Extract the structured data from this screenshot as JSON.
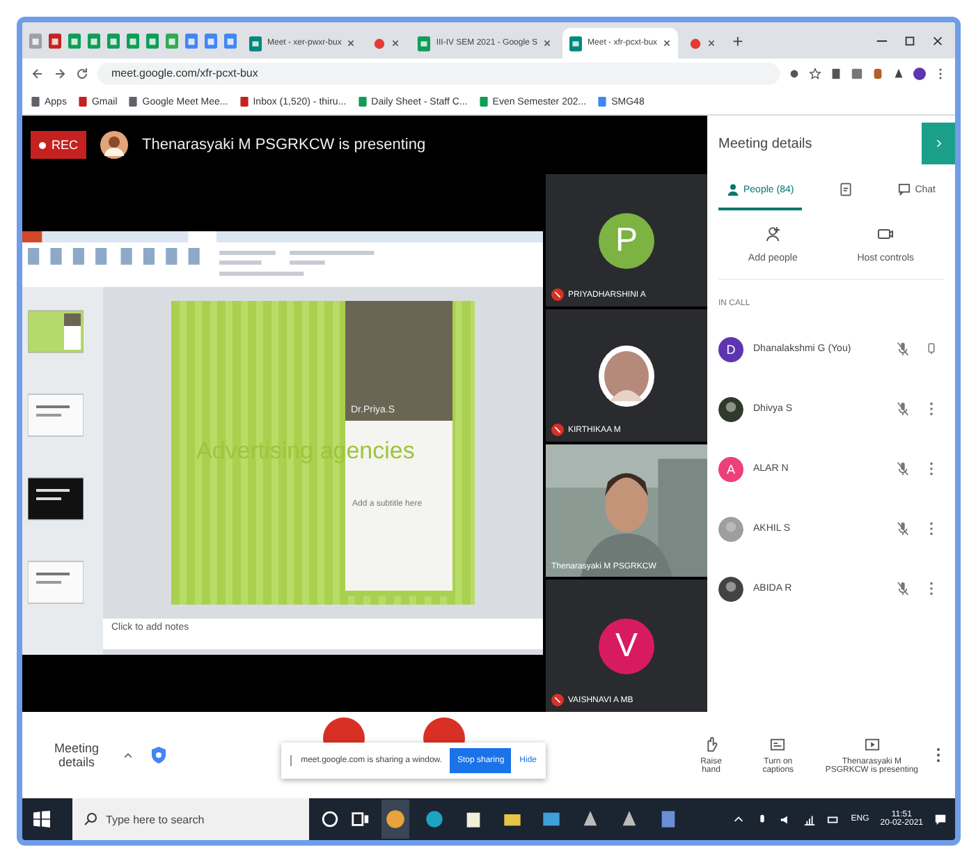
{
  "browser": {
    "pinned_tabs": [
      {
        "kind": "page"
      },
      {
        "kind": "mail"
      },
      {
        "kind": "sheet"
      },
      {
        "kind": "sheet"
      },
      {
        "kind": "sheet"
      },
      {
        "kind": "sheet"
      },
      {
        "kind": "sheet"
      },
      {
        "kind": "drive"
      },
      {
        "kind": "doc"
      },
      {
        "kind": "doc"
      },
      {
        "kind": "doc"
      }
    ],
    "tabs": [
      {
        "kind": "meet",
        "title": "Meet - xer-pwxr-bux",
        "selected": false
      },
      {
        "kind": "record",
        "selected": false
      },
      {
        "kind": "sheet",
        "title": "III-IV SEM 2021 - Google S",
        "selected": false
      },
      {
        "kind": "meet",
        "title": "Meet - xfr-pcxt-bux",
        "selected": true
      },
      {
        "kind": "record",
        "selected": false
      }
    ],
    "new_tab": "+",
    "url": "meet.google.com/xfr-pcxt-bux",
    "bookmarks": [
      {
        "kind": "apps",
        "label": "Apps"
      },
      {
        "kind": "mail",
        "label": "Gmail"
      },
      {
        "kind": "globe",
        "label": "Google Meet Mee..."
      },
      {
        "kind": "mail",
        "label": "Inbox (1,520) - thiru..."
      },
      {
        "kind": "sheet",
        "label": "Daily Sheet - Staff C..."
      },
      {
        "kind": "sheet",
        "label": "Even Semester 202..."
      },
      {
        "kind": "doc",
        "label": "SMG48"
      }
    ]
  },
  "meet": {
    "rec": "REC",
    "presenter": "Thenarasyaki M PSGRKCW is presenting",
    "slide": {
      "title": "Advertising agencies",
      "author": "Dr.Priya.S",
      "subtitle": "Add a subtitle here",
      "notes": "Click to add notes"
    },
    "tiles": [
      {
        "kind": "letter",
        "initial": "P",
        "color": "#7cb342",
        "name": "PRIYADHARSHINI A",
        "muted": true
      },
      {
        "name": "KIRTHIKAA M",
        "muted": true
      },
      {
        "kind": "video",
        "name": "Thenarasyaki M PSGRKCW",
        "muted": false
      },
      {
        "kind": "letter",
        "initial": "V",
        "color": "#d81b60",
        "name": "VAISHNAVI A MB",
        "muted": true
      }
    ]
  },
  "panel": {
    "title": "Meeting details",
    "tabs": [
      {
        "kind": "people",
        "label": "People (84)",
        "selected": true
      },
      {
        "kind": "info",
        "selected": false
      },
      {
        "kind": "chat",
        "label": "Chat",
        "selected": false
      }
    ],
    "actions": [
      {
        "kind": "add",
        "label": "Add people"
      },
      {
        "kind": "host",
        "label": "Host controls"
      }
    ],
    "section": "IN CALL",
    "people": [
      {
        "kind": "letter",
        "initial": "D",
        "color": "#5e35b1",
        "name": "Dhanalakshmi G (You)",
        "menu": false
      },
      {
        "color": "#2e3b2a",
        "name": "Dhivya S",
        "menu": true
      },
      {
        "kind": "letter",
        "initial": "A",
        "color": "#ec407a",
        "name": "ALAR N",
        "menu": true
      },
      {
        "color": "#9e9e9e",
        "name": "AKHIL S",
        "menu": true
      },
      {
        "color": "#424242",
        "name": "ABIDA R",
        "menu": true
      }
    ]
  },
  "controls": {
    "details": "Meeting details",
    "share_notice": "meet.google.com is sharing a window.",
    "stop": "Stop sharing",
    "hide": "Hide",
    "raise": "Raise hand",
    "captions": "Turn on captions",
    "presenting": "Thenarasyaki M PSGRKCW is presenting"
  },
  "taskbar": {
    "search": {
      "placeholder": "Type here to search"
    },
    "apps": [
      {
        "kind": "chrome"
      },
      {
        "kind": "edge"
      },
      {
        "kind": "store"
      },
      {
        "kind": "folder"
      },
      {
        "kind": "mail"
      },
      {
        "kind": "app"
      },
      {
        "kind": "app"
      },
      {
        "kind": "doc"
      }
    ],
    "lang": "ENG",
    "time": "11:51",
    "date": "20-02-2021"
  }
}
